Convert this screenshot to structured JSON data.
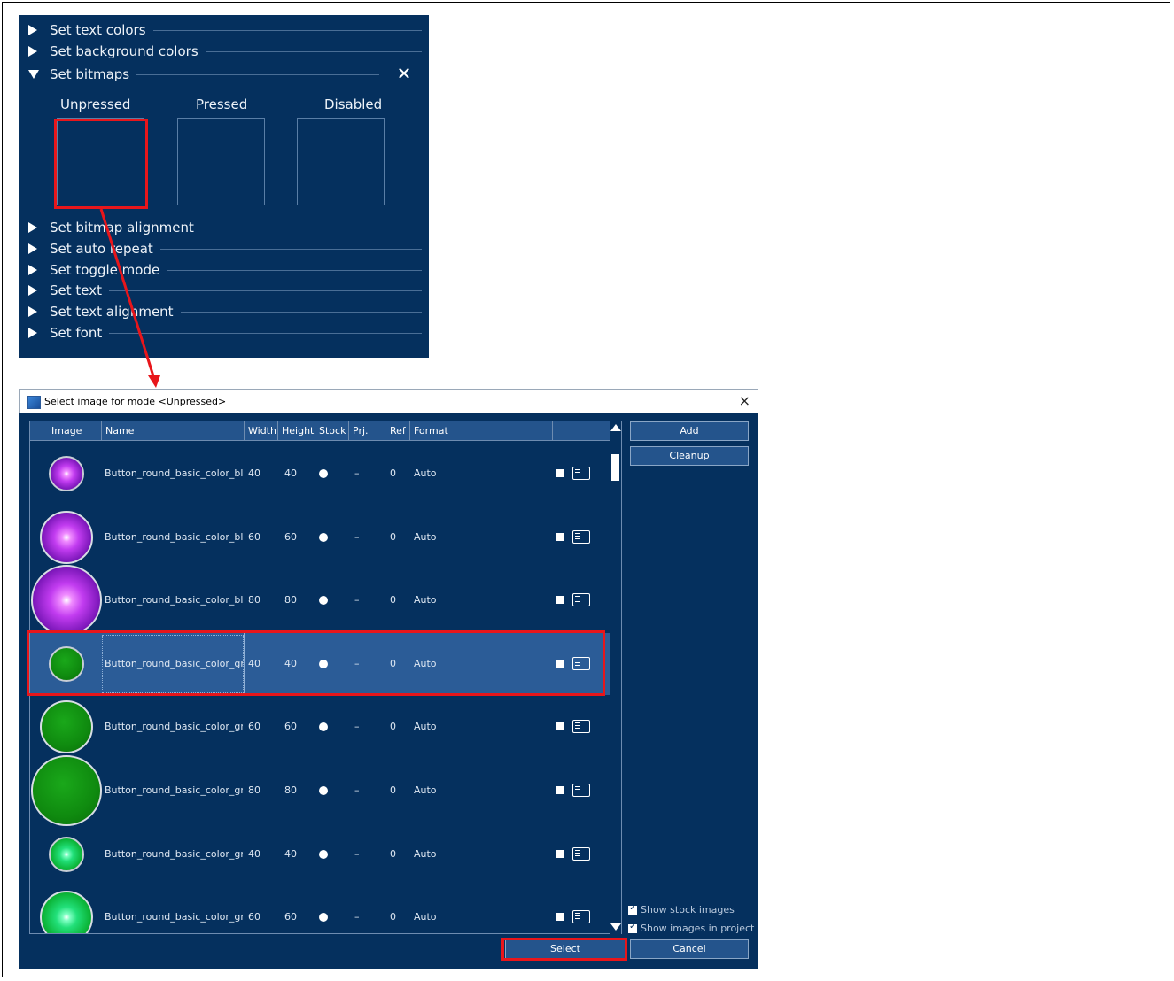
{
  "panel": {
    "sections_top": [
      "Set text colors",
      "Set background colors"
    ],
    "bitmaps_section": "Set bitmaps",
    "modes": [
      "Unpressed",
      "Pressed",
      "Disabled"
    ],
    "sections_bottom": [
      "Set bitmap alignment",
      "Set auto repeat",
      "Set toggle mode",
      "Set text",
      "Set text alignment",
      "Set font"
    ]
  },
  "dialog": {
    "title": "Select image for mode <Unpressed>",
    "close_glyph": "×",
    "columns": [
      "Image",
      "Name",
      "Width",
      "Height",
      "Stock",
      "Prj.",
      "Ref",
      "Format"
    ],
    "rows": [
      {
        "name": "Button_round_basic_color_blu⋯",
        "width": "40",
        "height": "40",
        "prj": "–",
        "ref": "0",
        "format": "Auto",
        "thumb_color": "purple",
        "size": 40
      },
      {
        "name": "Button_round_basic_color_blu⋯",
        "width": "60",
        "height": "60",
        "prj": "–",
        "ref": "0",
        "format": "Auto",
        "thumb_color": "purple",
        "size": 60
      },
      {
        "name": "Button_round_basic_color_blu⋯",
        "width": "80",
        "height": "80",
        "prj": "–",
        "ref": "0",
        "format": "Auto",
        "thumb_color": "purple",
        "size": 80
      },
      {
        "name": "Button_round_basic_color_gr⋯",
        "width": "40",
        "height": "40",
        "prj": "–",
        "ref": "0",
        "format": "Auto",
        "thumb_color": "green",
        "size": 40,
        "selected": true
      },
      {
        "name": "Button_round_basic_color_gr⋯",
        "width": "60",
        "height": "60",
        "prj": "–",
        "ref": "0",
        "format": "Auto",
        "thumb_color": "green",
        "size": 60
      },
      {
        "name": "Button_round_basic_color_gr⋯",
        "width": "80",
        "height": "80",
        "prj": "–",
        "ref": "0",
        "format": "Auto",
        "thumb_color": "green",
        "size": 80
      },
      {
        "name": "Button_round_basic_color_gr⋯",
        "width": "40",
        "height": "40",
        "prj": "–",
        "ref": "0",
        "format": "Auto",
        "thumb_color": "light-green",
        "size": 40
      },
      {
        "name": "Button_round_basic_color_gr⋯",
        "width": "60",
        "height": "60",
        "prj": "–",
        "ref": "0",
        "format": "Auto",
        "thumb_color": "light-green",
        "size": 60
      }
    ],
    "buttons": {
      "add": "Add",
      "cleanup": "Cleanup",
      "select": "Select",
      "cancel": "Cancel"
    },
    "checkboxes": {
      "show_stock": "Show stock images",
      "show_project": "Show images in project"
    }
  },
  "colors": {
    "panel_bg": "#05305e",
    "selected_row": "#2b5c97",
    "highlight": "#e8161b"
  }
}
